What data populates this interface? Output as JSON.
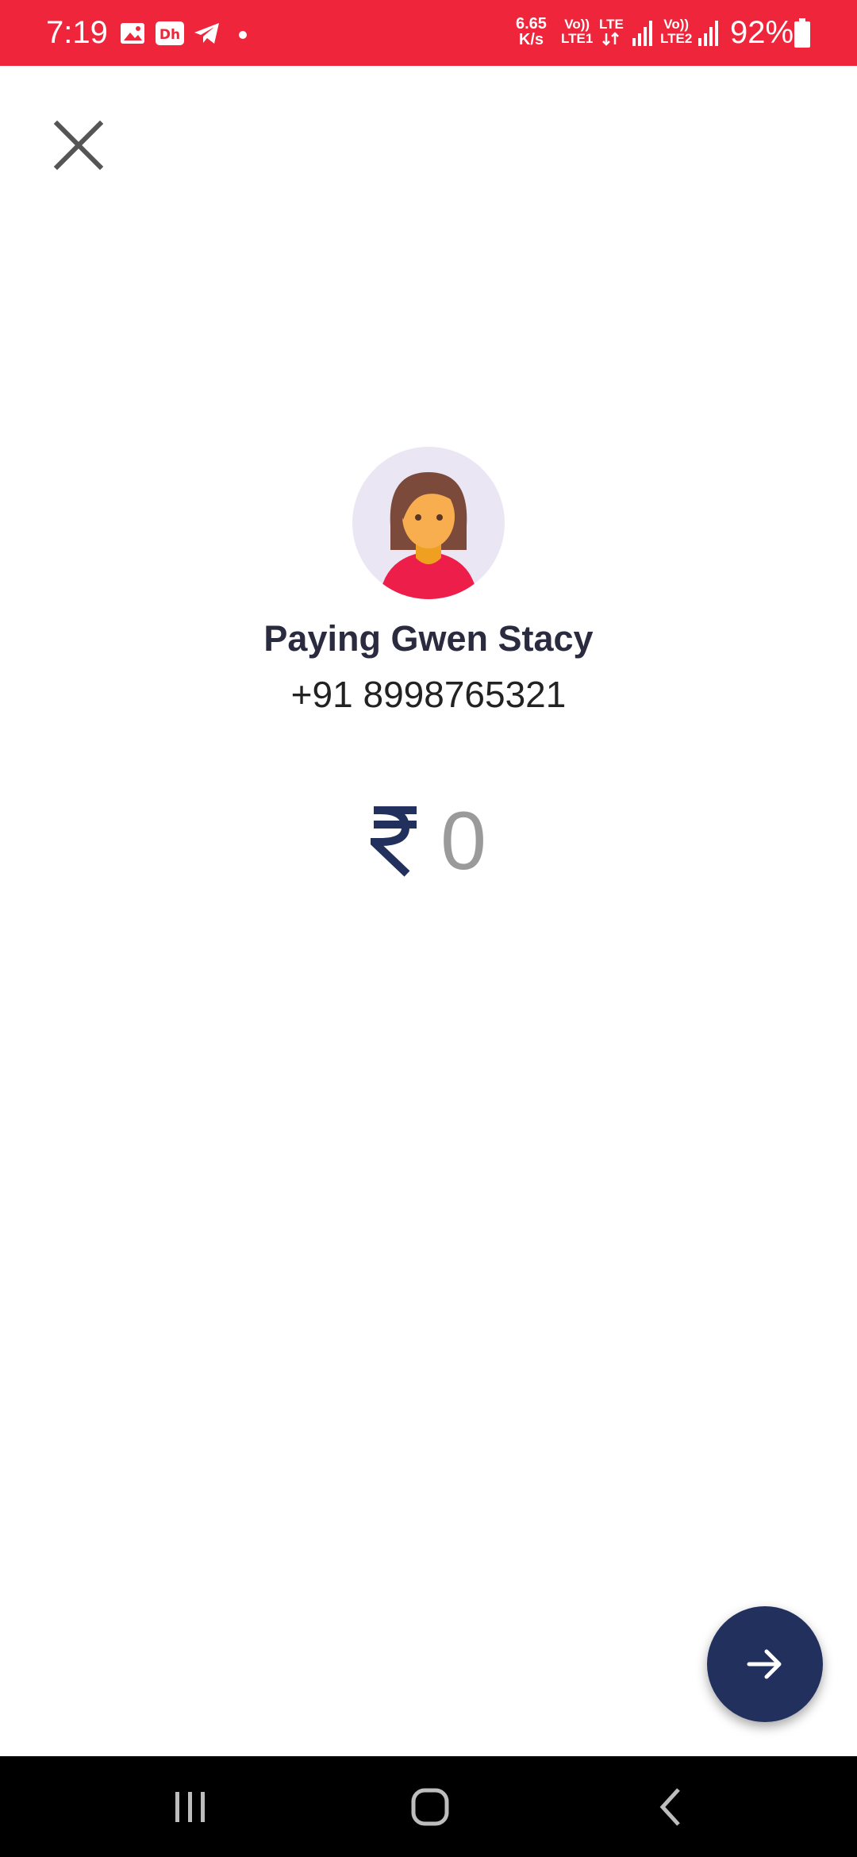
{
  "status_bar": {
    "time": "7:19",
    "speed_value": "6.65",
    "speed_unit": "K/s",
    "sim1_line1": "Vo))",
    "sim1_line2": "LTE1",
    "lte_label": "LTE",
    "sim2_line1": "Vo))",
    "sim2_line2": "LTE2",
    "battery": "92%",
    "icons": [
      "gallery-icon",
      "dh-app-icon",
      "telegram-icon",
      "dot-icon",
      "arrows-icon",
      "signal-icon",
      "signal-icon",
      "battery-icon"
    ]
  },
  "header": {
    "close_icon": "close-icon"
  },
  "payee": {
    "name": "Paying Gwen Stacy",
    "phone": "+91 8998765321",
    "avatar_icon": "avatar-woman-icon"
  },
  "amount": {
    "currency_icon": "rupee-icon",
    "value": "0"
  },
  "fab": {
    "icon": "arrow-right-icon"
  },
  "nav": {
    "items": [
      "recents-icon",
      "home-icon",
      "back-icon"
    ]
  },
  "colors": {
    "status_bar": "#ef263b",
    "fab": "#22305e",
    "rupee": "#22305e",
    "amount_placeholder": "#9a9a9a",
    "avatar_bg": "#ebe6f3"
  }
}
